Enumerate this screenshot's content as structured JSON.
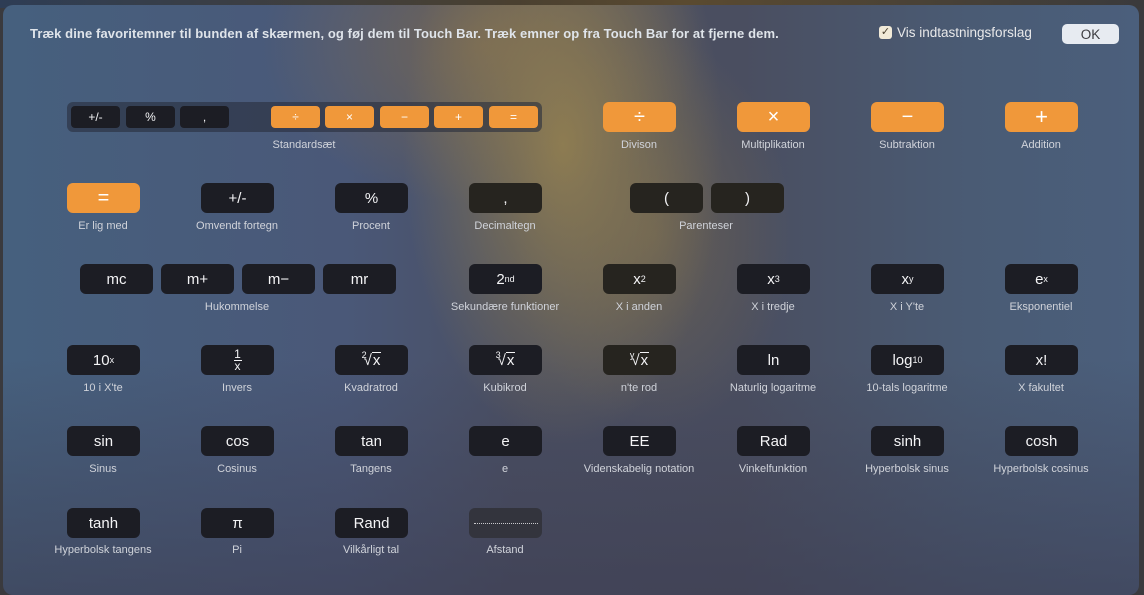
{
  "header": {
    "instruction": "Træk dine favoritemner til bunden af skærmen, og føj dem til Touch Bar. Træk emner op fra Touch Bar for at fjerne dem.",
    "suggestions_label": "Vis indtastningsforslag",
    "suggestions_checked": true,
    "check_glyph": "✓",
    "ok_label": "OK"
  },
  "colors": {
    "orange": "#f0983a",
    "key_dark": "#1c1d24"
  },
  "standard_set": {
    "label": "Standardsæt",
    "keys": [
      "+/-",
      "%",
      ",",
      "÷",
      "×",
      "−",
      "+",
      "="
    ]
  },
  "items": {
    "division": {
      "key": "÷",
      "label": "Divison"
    },
    "multiplication": {
      "key": "×",
      "label": "Multiplikation"
    },
    "subtraction": {
      "key": "−",
      "label": "Subtraktion"
    },
    "addition": {
      "key": "+",
      "label": "Addition"
    },
    "equals": {
      "key": "=",
      "label": "Er lig med"
    },
    "negate": {
      "key": "+/-",
      "label": "Omvendt fortegn"
    },
    "percent": {
      "key": "%",
      "label": "Procent"
    },
    "decimal": {
      "key": ",",
      "label": "Decimaltegn"
    },
    "parentheses": {
      "open": "(",
      "close": ")",
      "label": "Parenteser"
    },
    "memory": {
      "keys": [
        "mc",
        "m+",
        "m−",
        "mr"
      ],
      "label": "Hukommelse"
    },
    "second": {
      "base": "2",
      "sup": "nd",
      "label": "Sekundære funktioner"
    },
    "x_squared": {
      "base": "x",
      "sup": "2",
      "label": "X i anden"
    },
    "x_cubed": {
      "base": "x",
      "sup": "3",
      "label": "X i tredje"
    },
    "x_pow_y": {
      "base": "x",
      "sup": "y",
      "label": "X i Y'te"
    },
    "exp": {
      "base": "e",
      "sup": "x",
      "label": "Eksponentiel"
    },
    "ten_pow_x": {
      "base": "10",
      "sup": "x",
      "label": "10 i X'te"
    },
    "inverse": {
      "num": "1",
      "den": "x",
      "label": "Invers"
    },
    "sqrt": {
      "index": "2",
      "radicand": "x",
      "label": "Kvadratrod"
    },
    "cbrt": {
      "index": "3",
      "radicand": "x",
      "label": "Kubikrod"
    },
    "nth_root": {
      "index": "y",
      "radicand": "x",
      "label": "n'te rod"
    },
    "ln": {
      "key": "ln",
      "label": "Naturlig logaritme"
    },
    "log10": {
      "base": "log",
      "sub": "10",
      "label": "10-tals logaritme"
    },
    "factorial": {
      "key": "x!",
      "label": "X fakultet"
    },
    "sin": {
      "key": "sin",
      "label": "Sinus"
    },
    "cos": {
      "key": "cos",
      "label": "Cosinus"
    },
    "tan": {
      "key": "tan",
      "label": "Tangens"
    },
    "e": {
      "key": "e",
      "label": "e"
    },
    "ee": {
      "key": "EE",
      "label": "Videnskabelig notation"
    },
    "rad": {
      "key": "Rad",
      "label": "Vinkelfunktion"
    },
    "sinh": {
      "key": "sinh",
      "label": "Hyperbolsk sinus"
    },
    "cosh": {
      "key": "cosh",
      "label": "Hyperbolsk cosinus"
    },
    "tanh": {
      "key": "tanh",
      "label": "Hyperbolsk tangens"
    },
    "pi": {
      "key": "π",
      "label": "Pi"
    },
    "rand": {
      "key": "Rand",
      "label": "Vilkårligt tal"
    },
    "space": {
      "label": "Afstand"
    }
  }
}
